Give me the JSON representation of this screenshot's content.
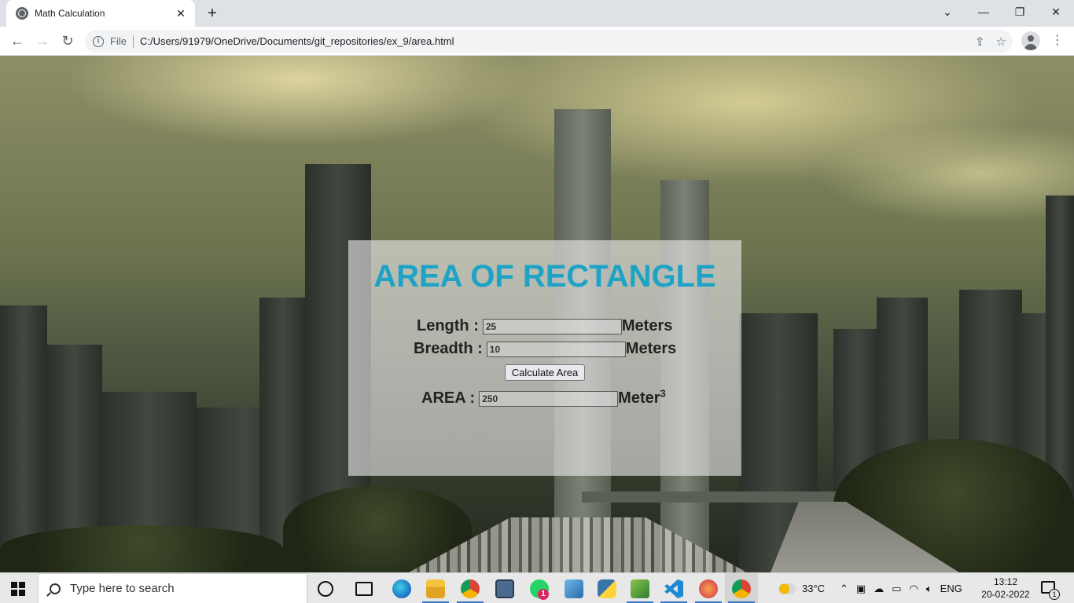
{
  "browser": {
    "tab_title": "Math Calculation",
    "address_scheme_label": "File",
    "address_url": "C:/Users/91979/OneDrive/Documents/git_repositories/ex_9/area.html"
  },
  "page": {
    "title": "AREA OF RECTANGLE",
    "length": {
      "label": "Length :",
      "value": "25",
      "unit": "Meters"
    },
    "breadth": {
      "label": "Breadth :",
      "value": "10",
      "unit": "Meters"
    },
    "calculate_button": "Calculate Area",
    "area": {
      "label": "AREA :",
      "value": "250",
      "unit": "Meter",
      "exponent": "3"
    },
    "title_color": "#1ea3c6"
  },
  "taskbar": {
    "search_placeholder": "Type here to search",
    "whatsapp_badge": "1",
    "weather": "33°C",
    "language": "ENG",
    "time": "13:12",
    "date": "20-02-2022",
    "notification_count": "1",
    "apps": [
      "task-view-icon",
      "edge-icon",
      "file-explorer-icon",
      "chrome-icon",
      "calculator-icon",
      "whatsapp-icon",
      "network-computer-icon",
      "python-icon",
      "notepad-plus-icon",
      "vscode-icon",
      "paint-icon",
      "chrome-active-icon"
    ]
  }
}
